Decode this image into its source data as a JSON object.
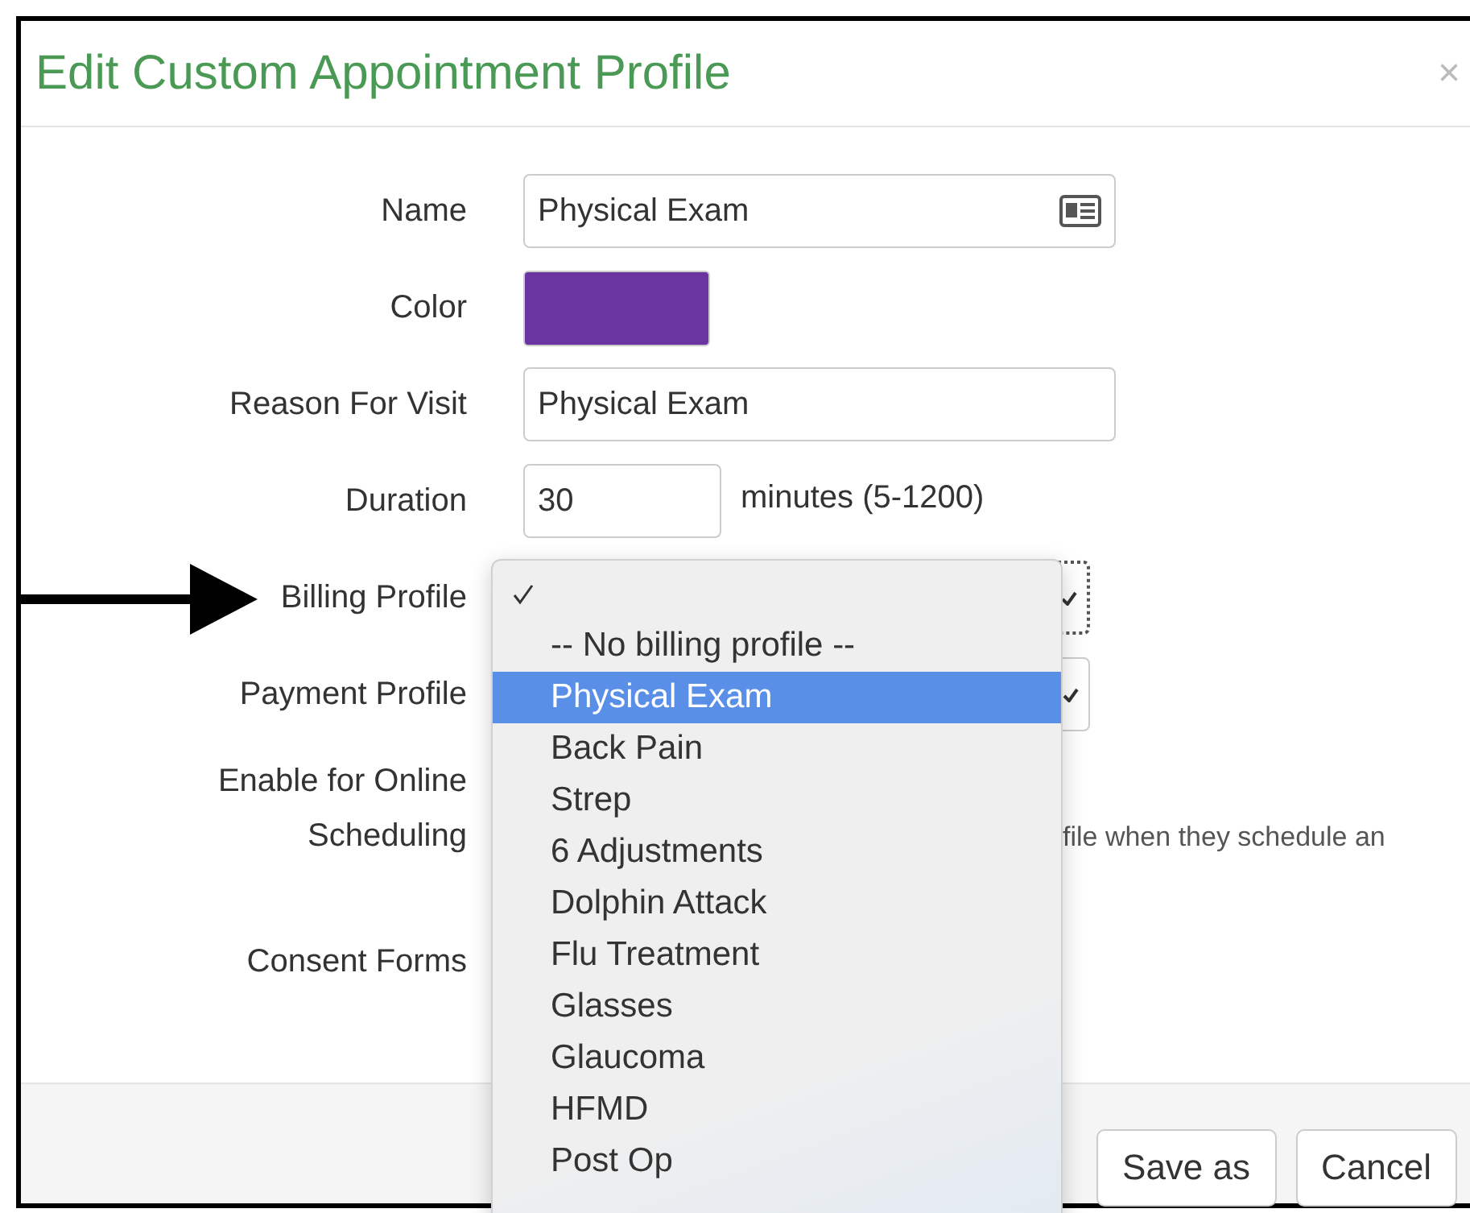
{
  "dialog": {
    "title": "Edit Custom Appointment Profile",
    "close": "×"
  },
  "form": {
    "name": {
      "label": "Name",
      "value": "Physical Exam"
    },
    "color": {
      "label": "Color",
      "color": "#6a35a0"
    },
    "reason": {
      "label": "Reason For Visit",
      "value": "Physical Exam"
    },
    "duration": {
      "label": "Duration",
      "value": "30",
      "unit": "minutes (5-1200)"
    },
    "billing": {
      "label": "Billing Profile",
      "focused": true
    },
    "payment": {
      "label": "Payment Profile"
    },
    "online": {
      "label": "Enable for Online Scheduling",
      "help": "file when they schedule an"
    },
    "consent": {
      "label": "Consent Forms"
    }
  },
  "dropdown": {
    "options": [
      {
        "checked": true,
        "highlighted": false
      },
      {
        "label": "-- No billing profile --",
        "checked": false,
        "highlighted": false
      },
      {
        "label": "Physical Exam",
        "checked": false,
        "highlighted": true
      },
      {
        "label": "Back Pain",
        "checked": false,
        "highlighted": false
      },
      {
        "label": "Strep",
        "checked": false,
        "highlighted": false
      },
      {
        "label": "6 Adjustments",
        "checked": false,
        "highlighted": false
      },
      {
        "label": "Dolphin Attack",
        "checked": false,
        "highlighted": false
      },
      {
        "label": "Flu Treatment",
        "checked": false,
        "highlighted": false
      },
      {
        "label": "Glasses",
        "checked": false,
        "highlighted": false
      },
      {
        "label": "Glaucoma",
        "checked": false,
        "highlighted": false
      },
      {
        "label": "HFMD",
        "checked": false,
        "highlighted": false
      },
      {
        "label": "Post Op",
        "checked": false,
        "highlighted": false
      }
    ]
  },
  "buttons": [
    "Save as",
    "Cancel"
  ]
}
